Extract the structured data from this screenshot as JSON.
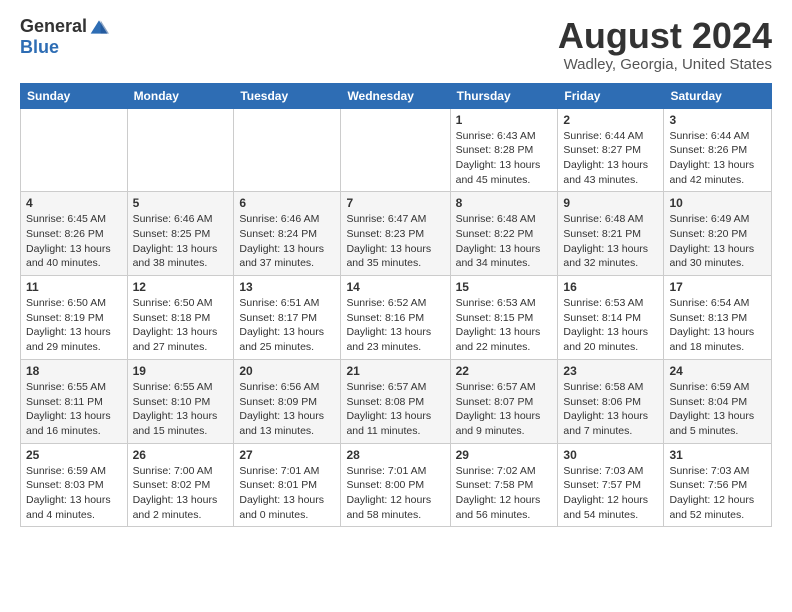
{
  "logo": {
    "general": "General",
    "blue": "Blue"
  },
  "header": {
    "title": "August 2024",
    "subtitle": "Wadley, Georgia, United States"
  },
  "weekdays": [
    "Sunday",
    "Monday",
    "Tuesday",
    "Wednesday",
    "Thursday",
    "Friday",
    "Saturday"
  ],
  "weeks": [
    [
      {
        "day": "",
        "info": ""
      },
      {
        "day": "",
        "info": ""
      },
      {
        "day": "",
        "info": ""
      },
      {
        "day": "",
        "info": ""
      },
      {
        "day": "1",
        "info": "Sunrise: 6:43 AM\nSunset: 8:28 PM\nDaylight: 13 hours\nand 45 minutes."
      },
      {
        "day": "2",
        "info": "Sunrise: 6:44 AM\nSunset: 8:27 PM\nDaylight: 13 hours\nand 43 minutes."
      },
      {
        "day": "3",
        "info": "Sunrise: 6:44 AM\nSunset: 8:26 PM\nDaylight: 13 hours\nand 42 minutes."
      }
    ],
    [
      {
        "day": "4",
        "info": "Sunrise: 6:45 AM\nSunset: 8:26 PM\nDaylight: 13 hours\nand 40 minutes."
      },
      {
        "day": "5",
        "info": "Sunrise: 6:46 AM\nSunset: 8:25 PM\nDaylight: 13 hours\nand 38 minutes."
      },
      {
        "day": "6",
        "info": "Sunrise: 6:46 AM\nSunset: 8:24 PM\nDaylight: 13 hours\nand 37 minutes."
      },
      {
        "day": "7",
        "info": "Sunrise: 6:47 AM\nSunset: 8:23 PM\nDaylight: 13 hours\nand 35 minutes."
      },
      {
        "day": "8",
        "info": "Sunrise: 6:48 AM\nSunset: 8:22 PM\nDaylight: 13 hours\nand 34 minutes."
      },
      {
        "day": "9",
        "info": "Sunrise: 6:48 AM\nSunset: 8:21 PM\nDaylight: 13 hours\nand 32 minutes."
      },
      {
        "day": "10",
        "info": "Sunrise: 6:49 AM\nSunset: 8:20 PM\nDaylight: 13 hours\nand 30 minutes."
      }
    ],
    [
      {
        "day": "11",
        "info": "Sunrise: 6:50 AM\nSunset: 8:19 PM\nDaylight: 13 hours\nand 29 minutes."
      },
      {
        "day": "12",
        "info": "Sunrise: 6:50 AM\nSunset: 8:18 PM\nDaylight: 13 hours\nand 27 minutes."
      },
      {
        "day": "13",
        "info": "Sunrise: 6:51 AM\nSunset: 8:17 PM\nDaylight: 13 hours\nand 25 minutes."
      },
      {
        "day": "14",
        "info": "Sunrise: 6:52 AM\nSunset: 8:16 PM\nDaylight: 13 hours\nand 23 minutes."
      },
      {
        "day": "15",
        "info": "Sunrise: 6:53 AM\nSunset: 8:15 PM\nDaylight: 13 hours\nand 22 minutes."
      },
      {
        "day": "16",
        "info": "Sunrise: 6:53 AM\nSunset: 8:14 PM\nDaylight: 13 hours\nand 20 minutes."
      },
      {
        "day": "17",
        "info": "Sunrise: 6:54 AM\nSunset: 8:13 PM\nDaylight: 13 hours\nand 18 minutes."
      }
    ],
    [
      {
        "day": "18",
        "info": "Sunrise: 6:55 AM\nSunset: 8:11 PM\nDaylight: 13 hours\nand 16 minutes."
      },
      {
        "day": "19",
        "info": "Sunrise: 6:55 AM\nSunset: 8:10 PM\nDaylight: 13 hours\nand 15 minutes."
      },
      {
        "day": "20",
        "info": "Sunrise: 6:56 AM\nSunset: 8:09 PM\nDaylight: 13 hours\nand 13 minutes."
      },
      {
        "day": "21",
        "info": "Sunrise: 6:57 AM\nSunset: 8:08 PM\nDaylight: 13 hours\nand 11 minutes."
      },
      {
        "day": "22",
        "info": "Sunrise: 6:57 AM\nSunset: 8:07 PM\nDaylight: 13 hours\nand 9 minutes."
      },
      {
        "day": "23",
        "info": "Sunrise: 6:58 AM\nSunset: 8:06 PM\nDaylight: 13 hours\nand 7 minutes."
      },
      {
        "day": "24",
        "info": "Sunrise: 6:59 AM\nSunset: 8:04 PM\nDaylight: 13 hours\nand 5 minutes."
      }
    ],
    [
      {
        "day": "25",
        "info": "Sunrise: 6:59 AM\nSunset: 8:03 PM\nDaylight: 13 hours\nand 4 minutes."
      },
      {
        "day": "26",
        "info": "Sunrise: 7:00 AM\nSunset: 8:02 PM\nDaylight: 13 hours\nand 2 minutes."
      },
      {
        "day": "27",
        "info": "Sunrise: 7:01 AM\nSunset: 8:01 PM\nDaylight: 13 hours\nand 0 minutes."
      },
      {
        "day": "28",
        "info": "Sunrise: 7:01 AM\nSunset: 8:00 PM\nDaylight: 12 hours\nand 58 minutes."
      },
      {
        "day": "29",
        "info": "Sunrise: 7:02 AM\nSunset: 7:58 PM\nDaylight: 12 hours\nand 56 minutes."
      },
      {
        "day": "30",
        "info": "Sunrise: 7:03 AM\nSunset: 7:57 PM\nDaylight: 12 hours\nand 54 minutes."
      },
      {
        "day": "31",
        "info": "Sunrise: 7:03 AM\nSunset: 7:56 PM\nDaylight: 12 hours\nand 52 minutes."
      }
    ]
  ]
}
